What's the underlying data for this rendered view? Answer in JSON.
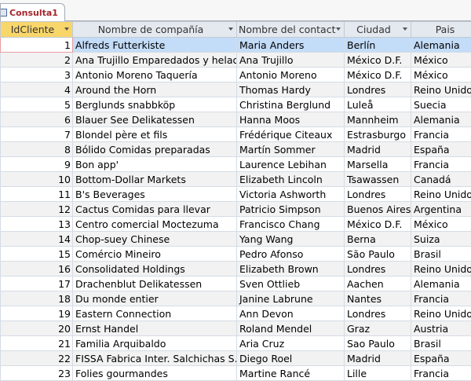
{
  "tab": {
    "title": "Consulta1"
  },
  "columns": [
    "IdCliente",
    "Nombre de compañía",
    "Nombre del contact",
    "Ciudad",
    "Pais"
  ],
  "rows": [
    [
      "1",
      "Alfreds Futterkiste",
      "Maria Anders",
      "Berlín",
      "Alemania"
    ],
    [
      "2",
      "Ana Trujillo Emparedados y helados",
      "Ana Trujillo",
      "México D.F.",
      "México"
    ],
    [
      "3",
      "Antonio Moreno Taquería",
      "Antonio Moreno",
      "México D.F.",
      "México"
    ],
    [
      "4",
      "Around the Horn",
      "Thomas Hardy",
      "Londres",
      "Reino Unido"
    ],
    [
      "5",
      "Berglunds snabbköp",
      "Christina Berglund",
      "Luleå",
      "Suecia"
    ],
    [
      "6",
      "Blauer See Delikatessen",
      "Hanna Moos",
      "Mannheim",
      "Alemania"
    ],
    [
      "7",
      "Blondel père et fils",
      "Frédérique Citeaux",
      "Estrasburgo",
      "Francia"
    ],
    [
      "8",
      "Bólido Comidas preparadas",
      "Martín Sommer",
      "Madrid",
      "España"
    ],
    [
      "9",
      "Bon app'",
      "Laurence Lebihan",
      "Marsella",
      "Francia"
    ],
    [
      "10",
      "Bottom-Dollar Markets",
      "Elizabeth Lincoln",
      "Tsawassen",
      "Canadá"
    ],
    [
      "11",
      "B's Beverages",
      "Victoria Ashworth",
      "Londres",
      "Reino Unido"
    ],
    [
      "12",
      "Cactus Comidas para llevar",
      "Patricio Simpson",
      "Buenos Aires",
      "Argentina"
    ],
    [
      "13",
      "Centro comercial Moctezuma",
      "Francisco Chang",
      "México D.F.",
      "México"
    ],
    [
      "14",
      "Chop-suey Chinese",
      "Yang Wang",
      "Berna",
      "Suiza"
    ],
    [
      "15",
      "Comércio Mineiro",
      "Pedro Afonso",
      "São Paulo",
      "Brasil"
    ],
    [
      "16",
      "Consolidated Holdings",
      "Elizabeth Brown",
      "Londres",
      "Reino Unido"
    ],
    [
      "17",
      "Drachenblut Delikatessen",
      "Sven Ottlieb",
      "Aachen",
      "Alemania"
    ],
    [
      "18",
      "Du monde entier",
      "Janine Labrune",
      "Nantes",
      "Francia"
    ],
    [
      "19",
      "Eastern Connection",
      "Ann Devon",
      "Londres",
      "Reino Unido"
    ],
    [
      "20",
      "Ernst Handel",
      "Roland Mendel",
      "Graz",
      "Austria"
    ],
    [
      "21",
      "Familia Arquibaldo",
      "Aria Cruz",
      "Sao Paulo",
      "Brasil"
    ],
    [
      "22",
      "FISSA Fabrica Inter. Salchichas S.A.",
      "Diego Roel",
      "Madrid",
      "España"
    ],
    [
      "23",
      "Folies gourmandes",
      "Martine Rancé",
      "Lille",
      "Francia"
    ]
  ]
}
